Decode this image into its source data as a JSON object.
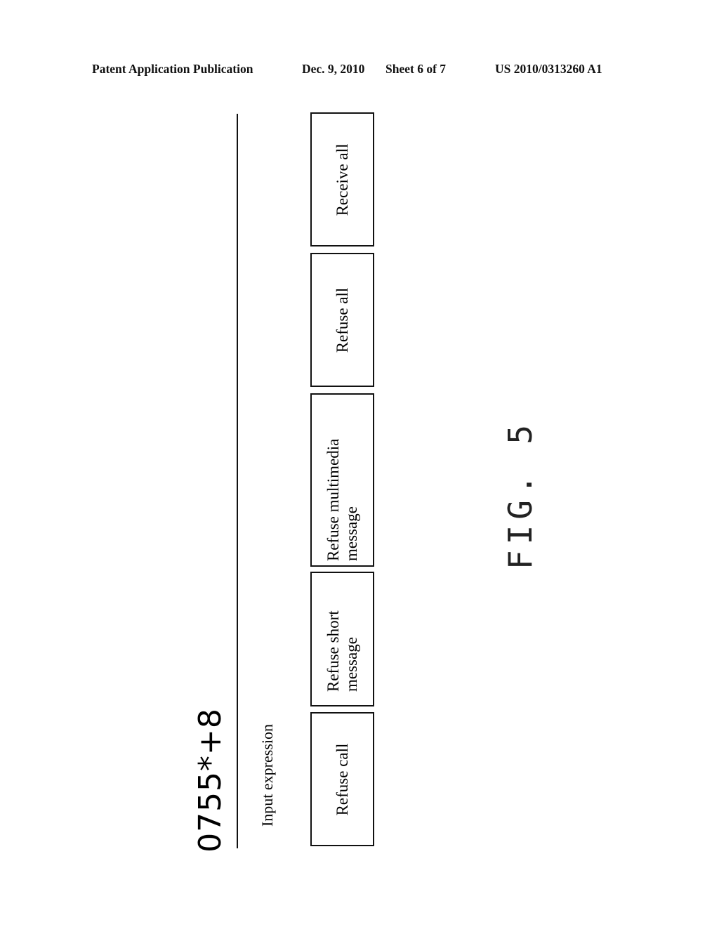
{
  "header": {
    "publication_type": "Patent Application Publication",
    "date": "Dec. 9, 2010",
    "sheet": "Sheet 6 of 7",
    "patent_number": "US 2010/0313260 A1"
  },
  "figure": {
    "screen": {
      "expression_value": "0755*+8",
      "input_label": "Input expression",
      "options": [
        {
          "label": "Refuse call"
        },
        {
          "label": "Refuse short message"
        },
        {
          "label": "Refuse multimedia message"
        },
        {
          "label": "Refuse all"
        },
        {
          "label": "Receive all"
        }
      ]
    },
    "caption": "FIG. 5"
  }
}
